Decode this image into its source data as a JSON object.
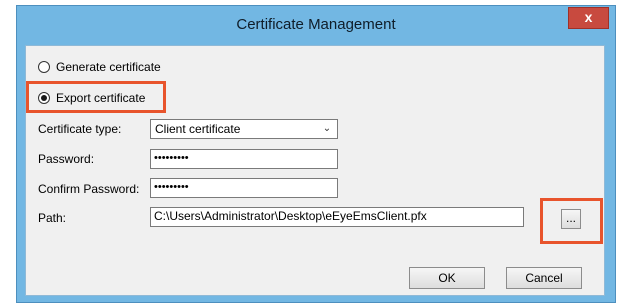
{
  "window": {
    "title": "Certificate Management",
    "close_label": "x"
  },
  "options": {
    "generate_label": "Generate certificate",
    "export_label": "Export certificate",
    "selected": "Export certificate"
  },
  "form": {
    "certificate_type_label": "Certificate type:",
    "certificate_type_value": "Client certificate",
    "password_label": "Password:",
    "password_value": "•••••••••",
    "confirm_password_label": "Confirm Password:",
    "confirm_password_value": "•••••••••",
    "path_label": "Path:",
    "path_value": "C:\\Users\\Administrator\\Desktop\\eEyeEmsClient.pfx",
    "browse_label": "..."
  },
  "buttons": {
    "ok_label": "OK",
    "cancel_label": "Cancel"
  },
  "colors": {
    "highlight": "#e8542c",
    "titlebar": "#72b7e3",
    "close_button": "#c84a3f"
  }
}
